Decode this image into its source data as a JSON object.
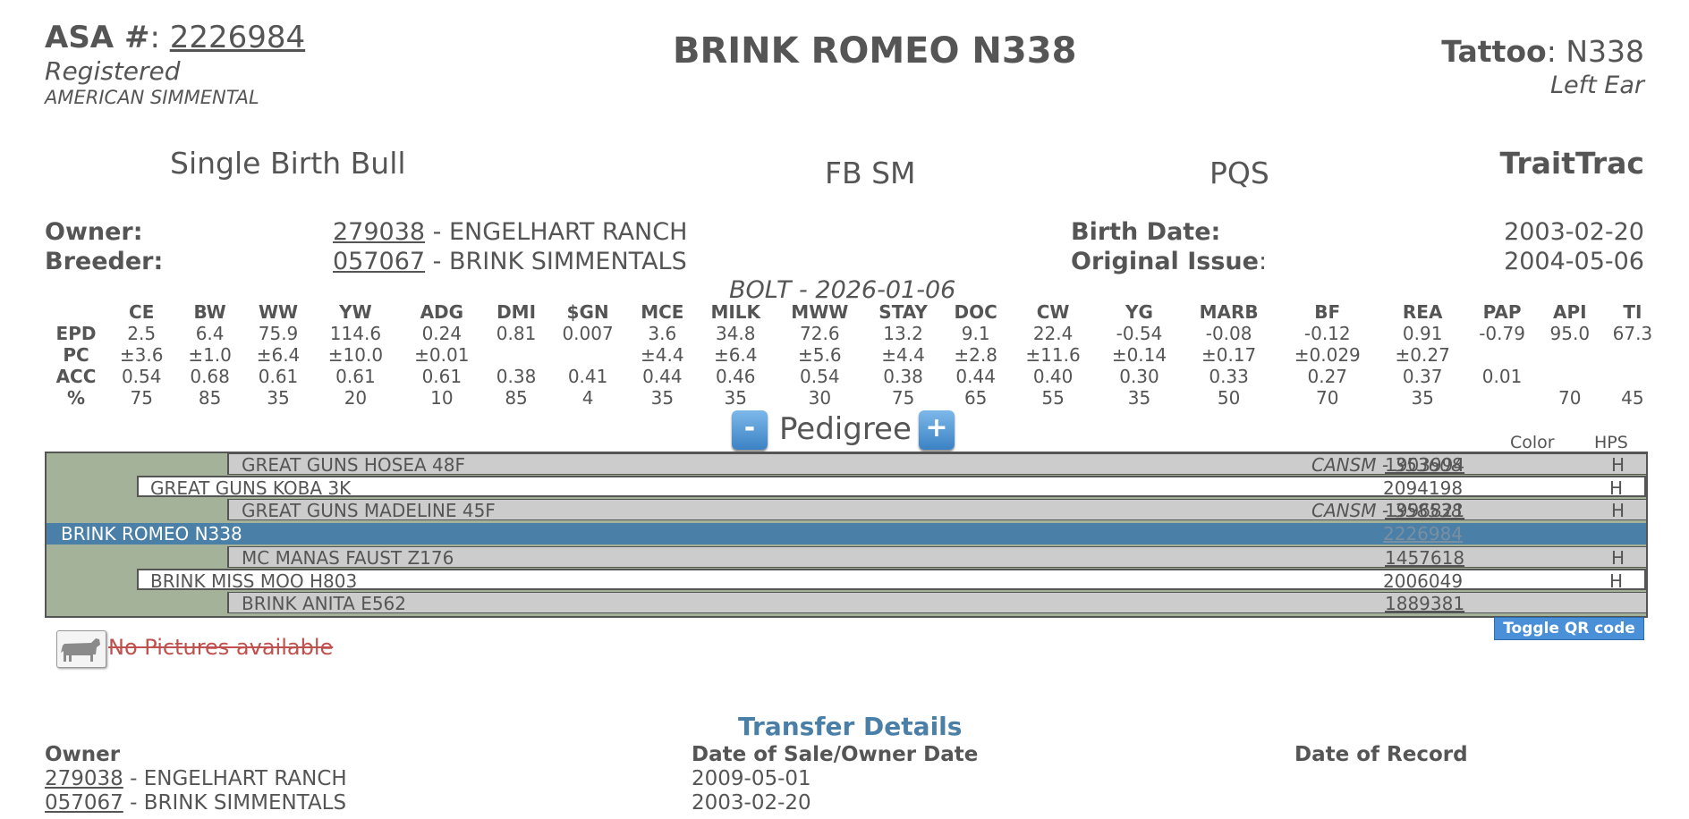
{
  "header": {
    "asa_label": "ASA #",
    "asa_number": "2226984",
    "status": "Registered",
    "breed_org": "AMERICAN SIMMENTAL",
    "animal_name": "BRINK ROMEO N338",
    "tattoo_label": "Tattoo",
    "tattoo_value": "N338",
    "tattoo_location": "Left Ear"
  },
  "info": {
    "birth_type": "Single Birth Bull",
    "breed_code": "FB SM",
    "pqs": "PQS",
    "traittrac": "TraitTrac",
    "owner_label": "Owner:",
    "owner_id": "279038",
    "owner_name": "- ENGELHART RANCH",
    "breeder_label": "Breeder:",
    "breeder_id": "057067",
    "breeder_name": "- BRINK SIMMENTALS",
    "birth_date_label": "Birth Date:",
    "birth_date": "2003-02-20",
    "original_issue_label": "Original Issue",
    "original_issue": "2004-05-06",
    "bolt_line": "BOLT - 2026-01-06"
  },
  "epd": {
    "columns": [
      "CE",
      "BW",
      "WW",
      "YW",
      "ADG",
      "DMI",
      "$GN",
      "MCE",
      "MILK",
      "MWW",
      "STAY",
      "DOC",
      "CW",
      "YG",
      "MARB",
      "BF",
      "REA",
      "PAP",
      "API",
      "TI"
    ],
    "rows": [
      {
        "label": "EPD",
        "values": [
          "2.5",
          "6.4",
          "75.9",
          "114.6",
          "0.24",
          "0.81",
          "0.007",
          "3.6",
          "34.8",
          "72.6",
          "13.2",
          "9.1",
          "22.4",
          "-0.54",
          "-0.08",
          "-0.12",
          "0.91",
          "-0.79",
          "95.0",
          "67.3"
        ]
      },
      {
        "label": "PC",
        "values": [
          "±3.6",
          "±1.0",
          "±6.4",
          "±10.0",
          "±0.01",
          "",
          "",
          "±4.4",
          "±6.4",
          "±5.6",
          "±4.4",
          "±2.8",
          "±11.6",
          "±0.14",
          "±0.17",
          "±0.029",
          "±0.27",
          "",
          "",
          ""
        ]
      },
      {
        "label": "ACC",
        "values": [
          "0.54",
          "0.68",
          "0.61",
          "0.61",
          "0.61",
          "0.38",
          "0.41",
          "0.44",
          "0.46",
          "0.54",
          "0.38",
          "0.44",
          "0.40",
          "0.30",
          "0.33",
          "0.27",
          "0.37",
          "0.01",
          "",
          ""
        ]
      },
      {
        "label": "%",
        "values": [
          "75",
          "85",
          "35",
          "20",
          "10",
          "85",
          "4",
          "35",
          "35",
          "30",
          "75",
          "65",
          "55",
          "35",
          "50",
          "70",
          "35",
          "",
          "70",
          "45"
        ]
      }
    ]
  },
  "pedigree": {
    "title": "Pedigree",
    "minus": "-",
    "plus": "+",
    "color_header": "Color",
    "hps_header": "HPS",
    "rows": [
      {
        "name": "GREAT GUNS HOSEA 48F",
        "cansm": "CANSM - 353608",
        "reg": "1903994",
        "hps": "H"
      },
      {
        "name": "GREAT GUNS KOBA 3K",
        "cansm": "",
        "reg": "2094198",
        "hps": "H"
      },
      {
        "name": "GREAT GUNS MADELINE 45F",
        "cansm": "CANSM - 358538",
        "reg": "1996821",
        "hps": "H"
      },
      {
        "name": "BRINK ROMEO N338",
        "cansm": "",
        "reg": "2226984",
        "hps": ""
      },
      {
        "name": "MC MANAS FAUST Z176",
        "cansm": "",
        "reg": "1457618",
        "hps": "H"
      },
      {
        "name": "BRINK MISS MOO H803",
        "cansm": "",
        "reg": "2006049",
        "hps": "H"
      },
      {
        "name": "BRINK ANITA E562",
        "cansm": "",
        "reg": "1889381",
        "hps": ""
      }
    ]
  },
  "pictures": {
    "no_pictures": "No Pictures available",
    "icon": "cow-icon"
  },
  "qr": {
    "toggle_label": "Toggle QR code"
  },
  "transfer": {
    "title": "Transfer Details",
    "owner_header": "Owner",
    "date_sale_header": "Date of Sale/Owner Date",
    "date_record_header": "Date of Record",
    "rows": [
      {
        "id": "279038",
        "name": "- ENGELHART RANCH",
        "date_sale": "2009-05-01",
        "date_record": ""
      },
      {
        "id": "057067",
        "name": "- BRINK SIMMENTALS",
        "date_sale": "2003-02-20",
        "date_record": ""
      }
    ]
  },
  "colors": {
    "text": "#555555",
    "selected_row": "#4a7fa7",
    "pedigree_bg": "#a5b29a",
    "pedigree_row": "#cccccc",
    "qr_button": "#4a90d9",
    "no_pictures": "#c0504d",
    "transfer_title": "#4a7fa7"
  }
}
